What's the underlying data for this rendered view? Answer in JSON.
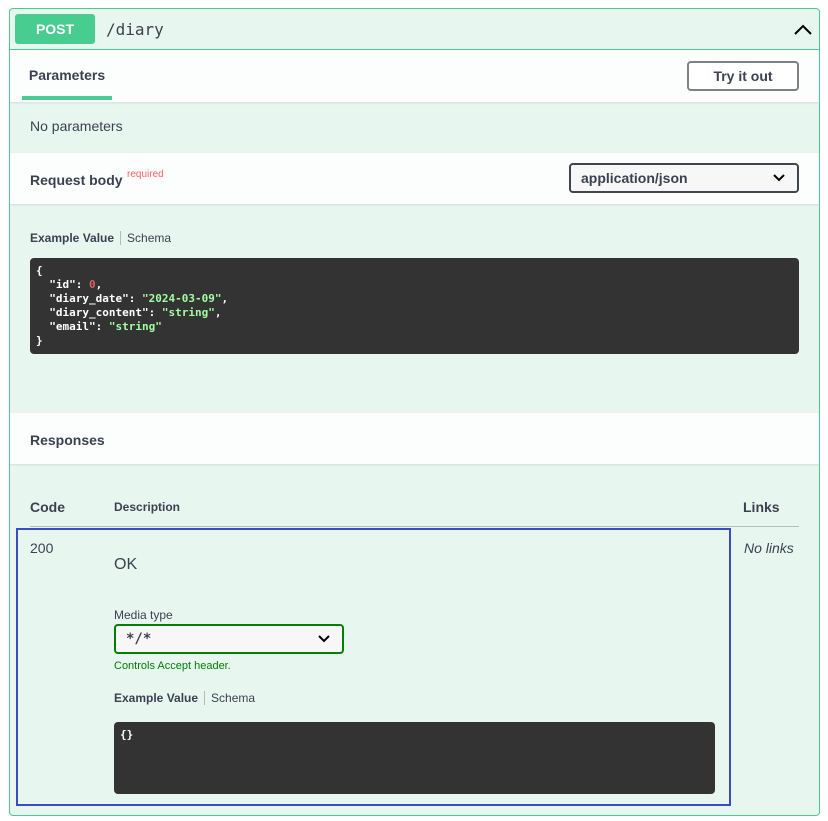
{
  "operation": {
    "method": "POST",
    "path": "/diary",
    "collapse_icon": "chevron-up-icon",
    "accent_color": "#49cc90"
  },
  "parameters": {
    "tab_label": "Parameters",
    "try_button": "Try it out",
    "empty_text": "No parameters"
  },
  "request_body": {
    "title": "Request body",
    "required_label": "required",
    "content_type": "application/json",
    "example_tab": "Example Value",
    "schema_tab": "Schema",
    "example": {
      "open": "{",
      "close": "}",
      "fields": [
        {
          "key": "\"id\"",
          "value": "0",
          "kind": "number"
        },
        {
          "key": "\"diary_date\"",
          "value": "\"2024-03-09\"",
          "kind": "string"
        },
        {
          "key": "\"diary_content\"",
          "value": "\"string\"",
          "kind": "string"
        },
        {
          "key": "\"email\"",
          "value": "\"string\"",
          "kind": "string"
        }
      ]
    }
  },
  "responses": {
    "title": "Responses",
    "columns": {
      "code": "Code",
      "description": "Description",
      "links": "Links"
    },
    "rows": [
      {
        "code": "200",
        "description": "OK",
        "media_type_label": "Media type",
        "media_type": "*/*",
        "accept_note": "Controls Accept header.",
        "example_tab": "Example Value",
        "schema_tab": "Schema",
        "example": "{}",
        "links": "No links"
      }
    ]
  }
}
